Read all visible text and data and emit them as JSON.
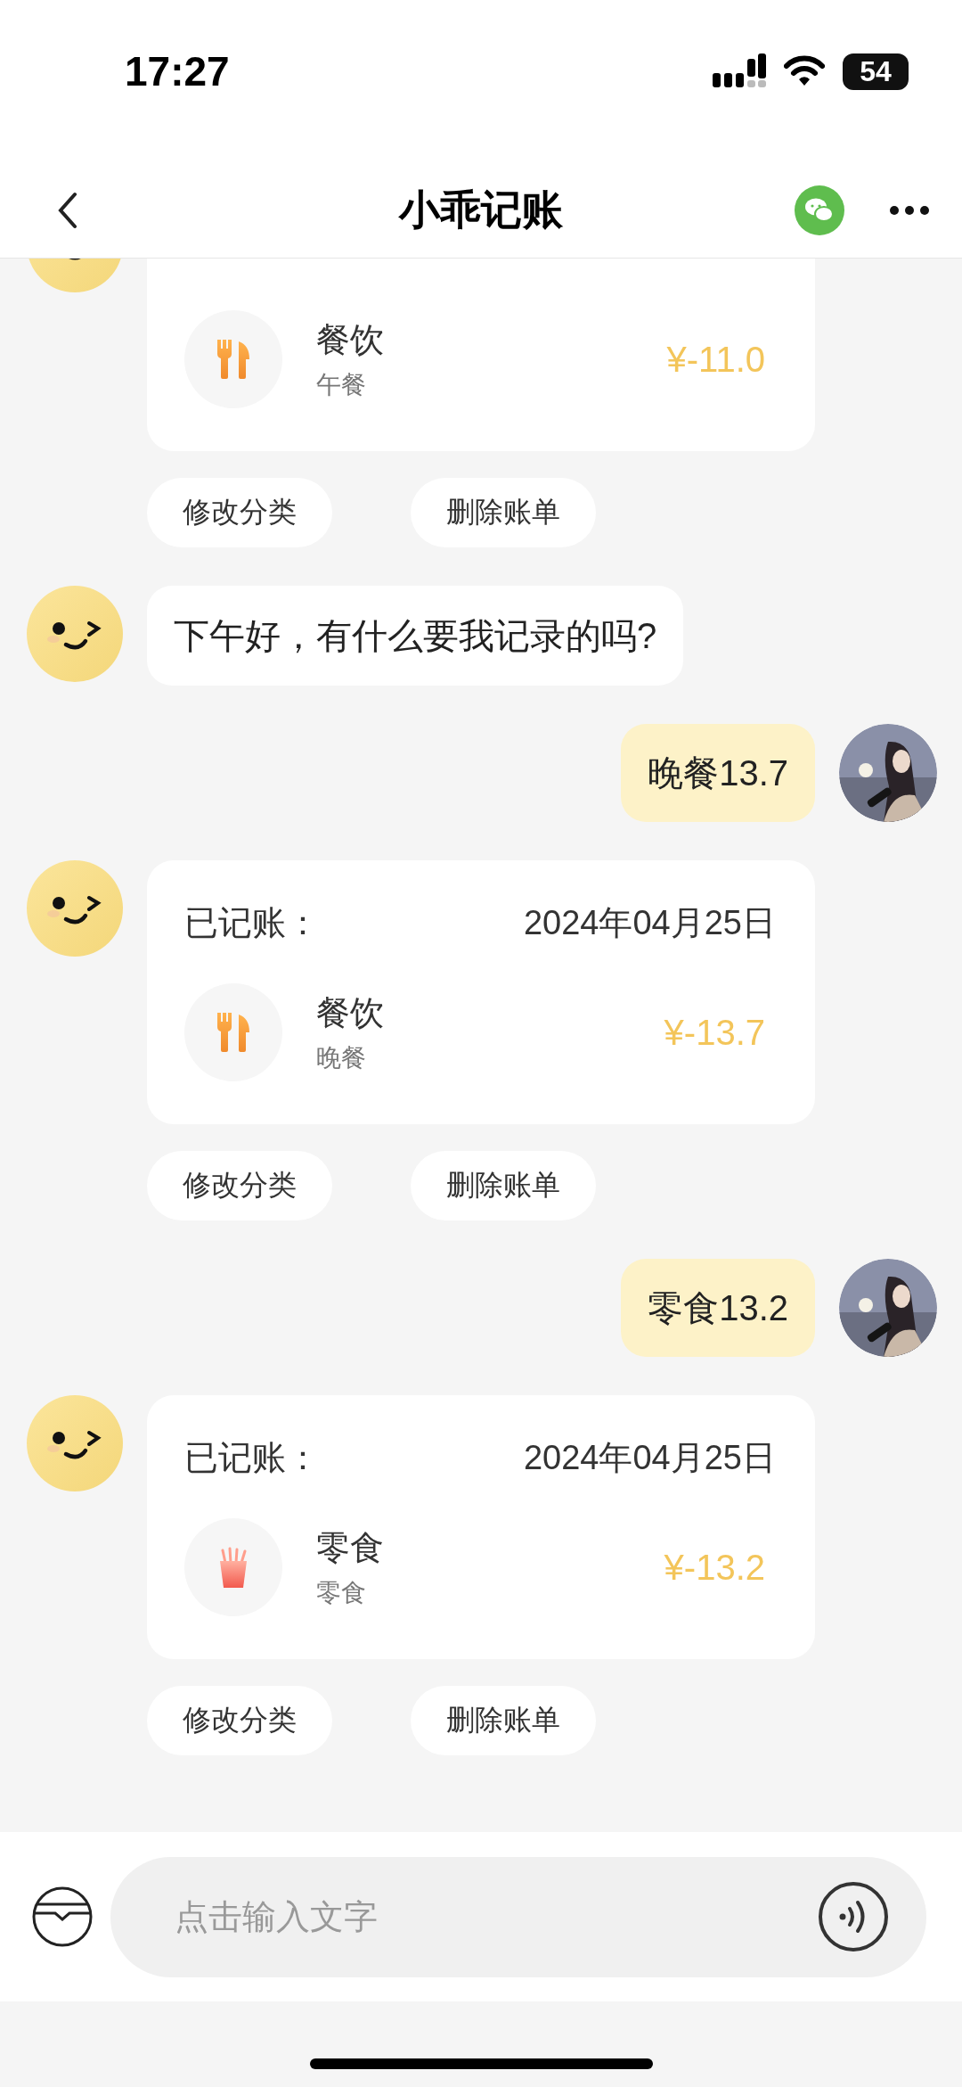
{
  "status_bar": {
    "time": "17:27",
    "battery": "54"
  },
  "nav": {
    "title": "小乖记账"
  },
  "messages": [
    {
      "kind": "bill",
      "entry": {
        "kind": "dining",
        "category": "餐饮",
        "note": "午餐",
        "amount": "¥-11.0"
      },
      "actions": [
        "修改分类",
        "删除账单"
      ]
    },
    {
      "kind": "bot_text",
      "text": "下午好，有什么要我记录的吗?"
    },
    {
      "kind": "user_text",
      "text": "晚餐13.7"
    },
    {
      "kind": "bill",
      "label": "已记账：",
      "date": "2024年04月25日",
      "entry": {
        "kind": "dining",
        "category": "餐饮",
        "note": "晚餐",
        "amount": "¥-13.7"
      },
      "actions": [
        "修改分类",
        "删除账单"
      ]
    },
    {
      "kind": "user_text",
      "text": "零食13.2"
    },
    {
      "kind": "bill",
      "label": "已记账：",
      "date": "2024年04月25日",
      "entry": {
        "kind": "snack",
        "category": "零食",
        "note": "零食",
        "amount": "¥-13.2"
      },
      "actions": [
        "修改分类",
        "删除账单"
      ]
    }
  ],
  "input": {
    "placeholder": "点击输入文字"
  }
}
